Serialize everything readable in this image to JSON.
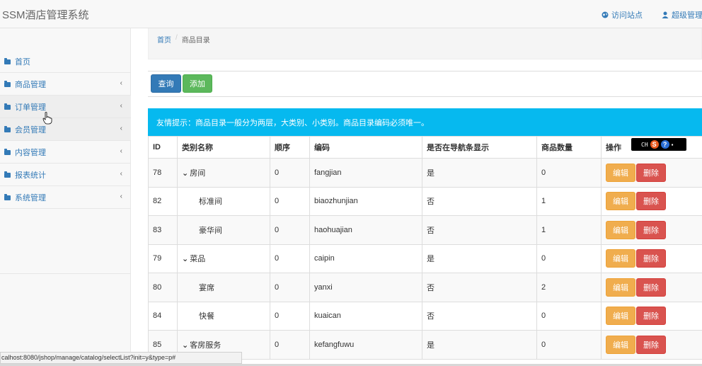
{
  "app": {
    "title": "SSM酒店管理系统"
  },
  "topnav": {
    "visit_label": "访问站点",
    "admin_label": "超级管理"
  },
  "sidebar": {
    "items": [
      {
        "label": "首页",
        "has_chevron": false
      },
      {
        "label": "商品管理",
        "has_chevron": true
      },
      {
        "label": "订单管理",
        "has_chevron": true
      },
      {
        "label": "会员管理",
        "has_chevron": true
      },
      {
        "label": "内容管理",
        "has_chevron": true
      },
      {
        "label": "报表统计",
        "has_chevron": true
      },
      {
        "label": "系统管理",
        "has_chevron": true
      }
    ],
    "chevron_glyph": "‹"
  },
  "breadcrumb": {
    "home": "首页",
    "separator": "/",
    "current": "商品目录"
  },
  "toolbar": {
    "query_label": "查询",
    "add_label": "添加"
  },
  "alert": {
    "text": "友情提示：商品目录一般分为两层，大类别、小类别。商品目录编码必须唯一。"
  },
  "table": {
    "headers": [
      "ID",
      "类别名称",
      "顺序",
      "编码",
      "是否在导航条显示",
      "商品数量",
      "操作"
    ],
    "edit_label": "编辑",
    "delete_label": "删除",
    "rows": [
      {
        "id": "78",
        "name": "房间",
        "parent": true,
        "order": "0",
        "code": "fangjian",
        "nav": "是",
        "count": "0"
      },
      {
        "id": "82",
        "name": "标准间",
        "parent": false,
        "order": "0",
        "code": "biaozhunjian",
        "nav": "否",
        "count": "1"
      },
      {
        "id": "83",
        "name": "豪华间",
        "parent": false,
        "order": "0",
        "code": "haohuajian",
        "nav": "否",
        "count": "1"
      },
      {
        "id": "79",
        "name": "菜品",
        "parent": true,
        "order": "0",
        "code": "caipin",
        "nav": "是",
        "count": "0"
      },
      {
        "id": "80",
        "name": "宴席",
        "parent": false,
        "order": "0",
        "code": "yanxi",
        "nav": "否",
        "count": "2"
      },
      {
        "id": "84",
        "name": "快餐",
        "parent": false,
        "order": "0",
        "code": "kuaican",
        "nav": "否",
        "count": "0"
      },
      {
        "id": "85",
        "name": "客房服务",
        "parent": true,
        "order": "0",
        "code": "kefangfuwu",
        "nav": "是",
        "count": "0"
      }
    ]
  },
  "ime": {
    "lang": "CH",
    "logo": "S",
    "help": "?",
    "menu": "▪"
  },
  "statusbar": {
    "url": "calhost:8080/jshop/manage/catalog/selectList?init=y&type=p#"
  },
  "colors": {
    "primary": "#337ab7",
    "success": "#5cb85c",
    "warning": "#f0ad4e",
    "danger": "#d9534f",
    "info": "#06b9ef"
  }
}
